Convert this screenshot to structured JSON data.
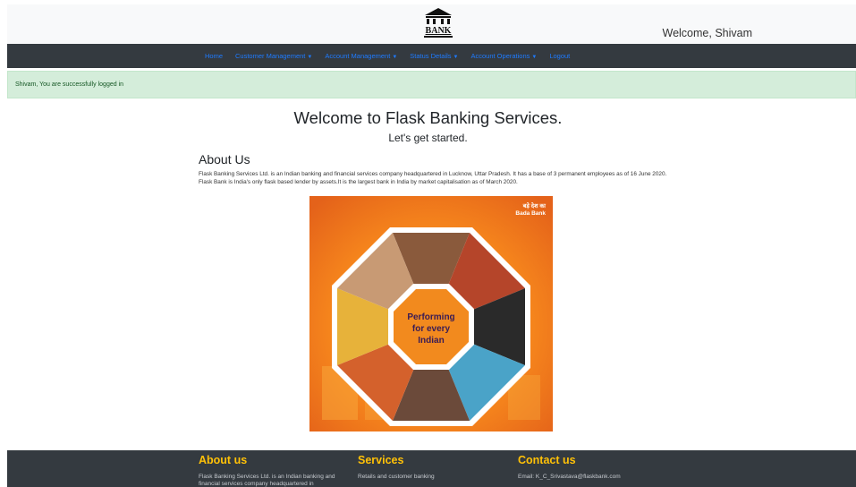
{
  "header": {
    "logo_text": "BANK",
    "welcome": "Welcome, Shivam"
  },
  "nav": {
    "items": [
      {
        "label": "Home",
        "dropdown": false
      },
      {
        "label": "Customer Management",
        "dropdown": true
      },
      {
        "label": "Account Management",
        "dropdown": true
      },
      {
        "label": "Status Details",
        "dropdown": true
      },
      {
        "label": "Account Operations",
        "dropdown": true
      },
      {
        "label": "Logout",
        "dropdown": false
      }
    ],
    "link_color": "#1e7bff"
  },
  "alert": {
    "message": "Shivam, You are successfully logged in"
  },
  "hero": {
    "title": "Welcome to Flask Banking Services.",
    "subtitle": "Let's get started."
  },
  "about": {
    "heading": "About Us",
    "text": "Flask Banking Services Ltd. is an Indian banking and financial services company headquartered in Lucknow, Uttar Pradesh. It has a base of 3 permanent employees as of 16 June 2020. Flask Bank is India's only flask based lender by assets.It is the largest bank in India by market capitalisation as of March 2020."
  },
  "poster": {
    "badge_line1": "बड़े देश का",
    "badge_line2": "Bada Bank",
    "center_line1": "Performing",
    "center_line2": "for every",
    "center_line3": "Indian"
  },
  "footer": {
    "about_heading": "About us",
    "about_text": "Flask Banking Services Ltd. is an Indian banking and financial services company headquartered in",
    "services_heading": "Services",
    "services_text": "Retails and customer banking",
    "contact_heading": "Contact us",
    "contact_text": "Email: K_C_Srivastava@flaskbank.com"
  },
  "colors": {
    "navbar_bg": "#343a40",
    "alert_bg": "#d4edda",
    "footer_heading": "#ffc107",
    "poster_orange": "#f28a1e"
  }
}
